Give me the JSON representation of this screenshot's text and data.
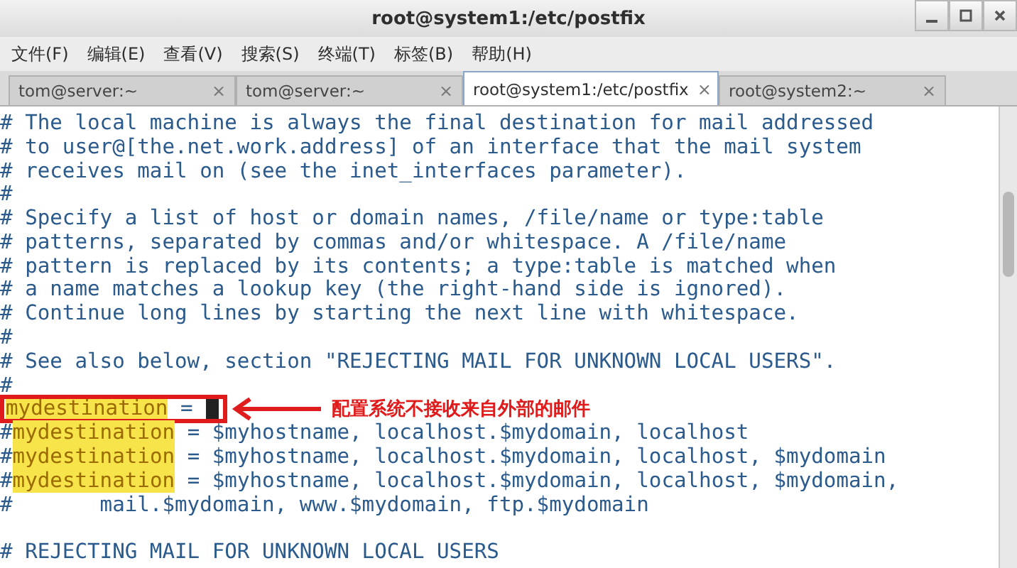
{
  "window": {
    "title": "root@system1:/etc/postfix"
  },
  "menu": [
    "文件(F)",
    "编辑(E)",
    "查看(V)",
    "搜索(S)",
    "终端(T)",
    "标签(B)",
    "帮助(H)"
  ],
  "tabs": [
    {
      "label": "tom@server:~",
      "selected": false,
      "close": "×"
    },
    {
      "label": "tom@server:~",
      "selected": false,
      "close": "×"
    },
    {
      "label": "root@system1:/etc/postfix",
      "selected": true,
      "close": "×"
    },
    {
      "label": "root@system2:~",
      "selected": false,
      "close": "×"
    }
  ],
  "lines": [
    {
      "segments": [
        {
          "kind": "comment",
          "text": "# The local machine is always the final destination for mail addressed"
        }
      ]
    },
    {
      "segments": [
        {
          "kind": "comment",
          "text": "# to user@[the.net.work.address] of an interface that the mail system"
        }
      ]
    },
    {
      "segments": [
        {
          "kind": "comment",
          "text": "# receives mail on (see the inet_interfaces parameter)."
        }
      ]
    },
    {
      "segments": [
        {
          "kind": "comment",
          "text": "#"
        }
      ]
    },
    {
      "segments": [
        {
          "kind": "comment",
          "text": "# Specify a list of host or domain names, /file/name or type:table"
        }
      ]
    },
    {
      "segments": [
        {
          "kind": "comment",
          "text": "# patterns, separated by commas and/or whitespace. A /file/name"
        }
      ]
    },
    {
      "segments": [
        {
          "kind": "comment",
          "text": "# pattern is replaced by its contents; a type:table is matched when"
        }
      ]
    },
    {
      "segments": [
        {
          "kind": "comment",
          "text": "# a name matches a lookup key (the right-hand side is ignored)."
        }
      ]
    },
    {
      "segments": [
        {
          "kind": "comment",
          "text": "# Continue long lines by starting the next line with whitespace."
        }
      ]
    },
    {
      "segments": [
        {
          "kind": "comment",
          "text": "#"
        }
      ]
    },
    {
      "segments": [
        {
          "kind": "comment",
          "text": "# See also below, section \"REJECTING MAIL FOR UNKNOWN LOCAL USERS\"."
        }
      ]
    },
    {
      "segments": [
        {
          "kind": "comment",
          "text": "#"
        }
      ]
    },
    {
      "segments": [
        {
          "kind": "match",
          "text": "mydestination"
        },
        {
          "kind": "plain",
          "text": " = "
        }
      ],
      "cursor": true,
      "annotation": "配置系统不接收来自外部的邮件"
    },
    {
      "segments": [
        {
          "kind": "comment",
          "text": "#"
        },
        {
          "kind": "match",
          "text": "mydestination"
        },
        {
          "kind": "comment",
          "text": " = $myhostname, localhost.$mydomain, localhost"
        }
      ]
    },
    {
      "segments": [
        {
          "kind": "comment",
          "text": "#"
        },
        {
          "kind": "match",
          "text": "mydestination"
        },
        {
          "kind": "comment",
          "text": " = $myhostname, localhost.$mydomain, localhost, $mydomain"
        }
      ]
    },
    {
      "segments": [
        {
          "kind": "comment",
          "text": "#"
        },
        {
          "kind": "match",
          "text": "mydestination"
        },
        {
          "kind": "comment",
          "text": " = $myhostname, localhost.$mydomain, localhost, $mydomain,"
        }
      ]
    },
    {
      "segments": [
        {
          "kind": "comment",
          "text": "#       mail.$mydomain, www.$mydomain, ftp.$mydomain"
        }
      ]
    },
    {
      "blank_before": true,
      "segments": [
        {
          "kind": "comment",
          "text": "# REJECTING MAIL FOR UNKNOWN LOCAL USERS"
        }
      ]
    }
  ]
}
